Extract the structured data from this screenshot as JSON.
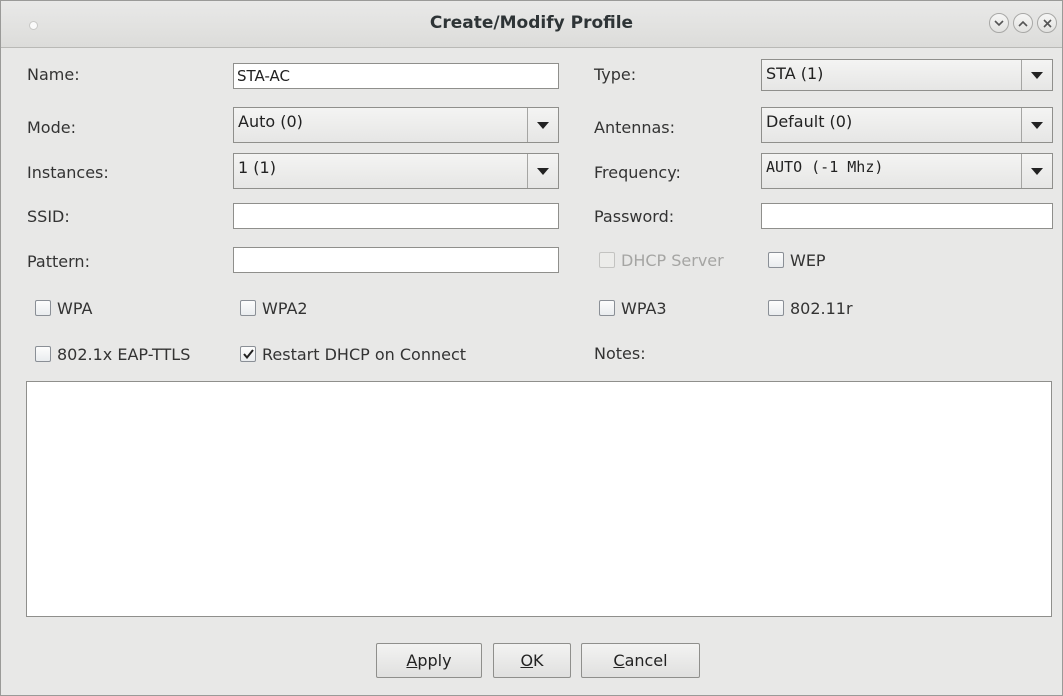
{
  "window": {
    "title": "Create/Modify Profile"
  },
  "form": {
    "name_label": "Name:",
    "name_value": "STA-AC",
    "type_label": "Type:",
    "type_value": "STA (1)",
    "mode_label": "Mode:",
    "mode_value": "Auto (0)",
    "antennas_label": "Antennas:",
    "antennas_value": "Default (0)",
    "instances_label": "Instances:",
    "instances_value": "1 (1)",
    "frequency_label": "Frequency:",
    "frequency_value": "AUTO (-1 Mhz)",
    "ssid_label": "SSID:",
    "ssid_value": "",
    "password_label": "Password:",
    "password_value": "",
    "pattern_label": "Pattern:",
    "pattern_value": "",
    "notes_label": "Notes:",
    "notes_value": ""
  },
  "checkboxes": {
    "dhcp_server": {
      "label": "DHCP Server",
      "checked": false,
      "enabled": false
    },
    "wep": {
      "label": "WEP",
      "checked": false
    },
    "wpa": {
      "label": "WPA",
      "checked": false
    },
    "wpa2": {
      "label": "WPA2",
      "checked": false
    },
    "wpa3": {
      "label": "WPA3",
      "checked": false
    },
    "r80211": {
      "label": "802.11r",
      "checked": false
    },
    "eap_ttls": {
      "label": "802.1x EAP-TTLS",
      "checked": false
    },
    "restart_dhcp": {
      "label": "Restart DHCP on Connect",
      "checked": true
    }
  },
  "buttons": {
    "apply": {
      "mnemonic": "A",
      "rest": "pply"
    },
    "ok": {
      "mnemonic": "O",
      "rest": "K"
    },
    "cancel": {
      "mnemonic": "C",
      "rest": "ancel"
    }
  },
  "icons": {
    "title_dot": "window-menu-icon",
    "minimize": "chevron-down-icon",
    "maximize": "chevron-up-icon",
    "close": "close-icon",
    "dropdown": "triangle-down-icon",
    "check": "checkmark-icon"
  }
}
